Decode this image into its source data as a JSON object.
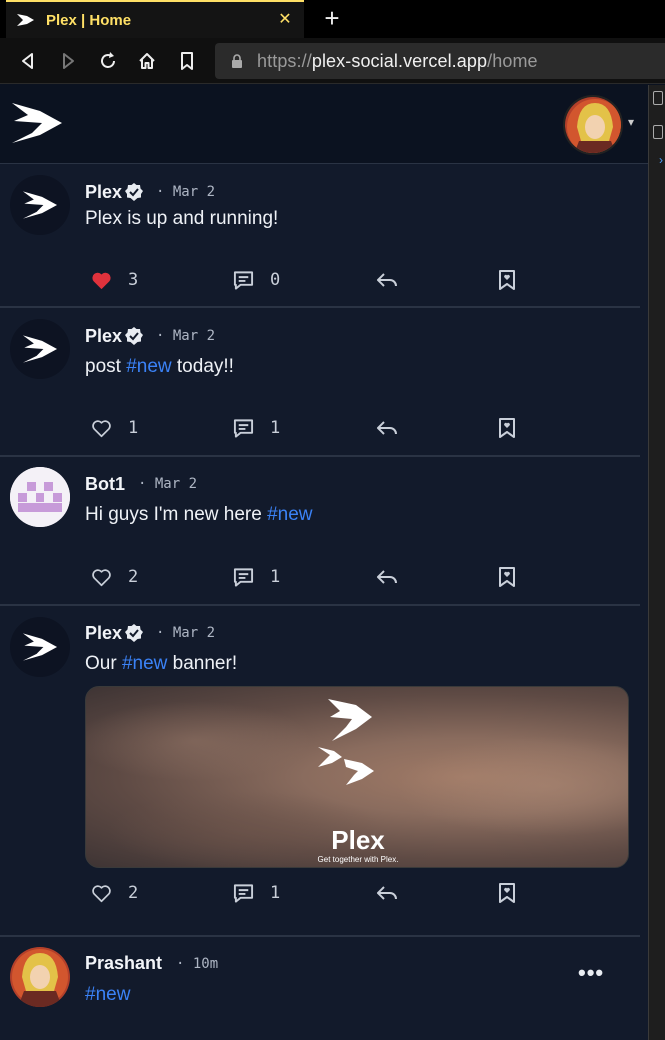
{
  "browser": {
    "tab_title": "Plex | Home",
    "tab_close": "✕",
    "new_tab": "+",
    "url_scheme": "https://",
    "url_host": "plex-social.vercel.app",
    "url_path": "/home"
  },
  "header": {
    "caret": "▾"
  },
  "posts": [
    {
      "author": "Plex",
      "verified": true,
      "date": "· Mar 2",
      "text": "Plex is up and running!",
      "likes": "3",
      "liked": true,
      "comments": "0"
    },
    {
      "author": "Plex",
      "verified": true,
      "date": "· Mar 2",
      "text_before": "post ",
      "hashtag": "#new",
      "text_after": " today!!",
      "likes": "1",
      "liked": false,
      "comments": "1"
    },
    {
      "author": "Bot1",
      "verified": false,
      "date": "· Mar 2",
      "text_before": "Hi guys I'm new here ",
      "hashtag": "#new",
      "text_after": "",
      "likes": "2",
      "liked": false,
      "comments": "1"
    },
    {
      "author": "Plex",
      "verified": true,
      "date": "· Mar 2",
      "text_before": "Our ",
      "hashtag": "#new",
      "text_after": " banner!",
      "likes": "2",
      "liked": false,
      "comments": "1",
      "banner": {
        "title": "Plex",
        "subtitle": "Get together with Plex."
      }
    },
    {
      "author": "Prashant",
      "verified": false,
      "date": "· 10m",
      "hashtag": "#new",
      "more": "•••"
    }
  ],
  "colors": {
    "accent": "#3b82f6",
    "like": "#e0323c",
    "tab_accent": "#ffe066"
  }
}
